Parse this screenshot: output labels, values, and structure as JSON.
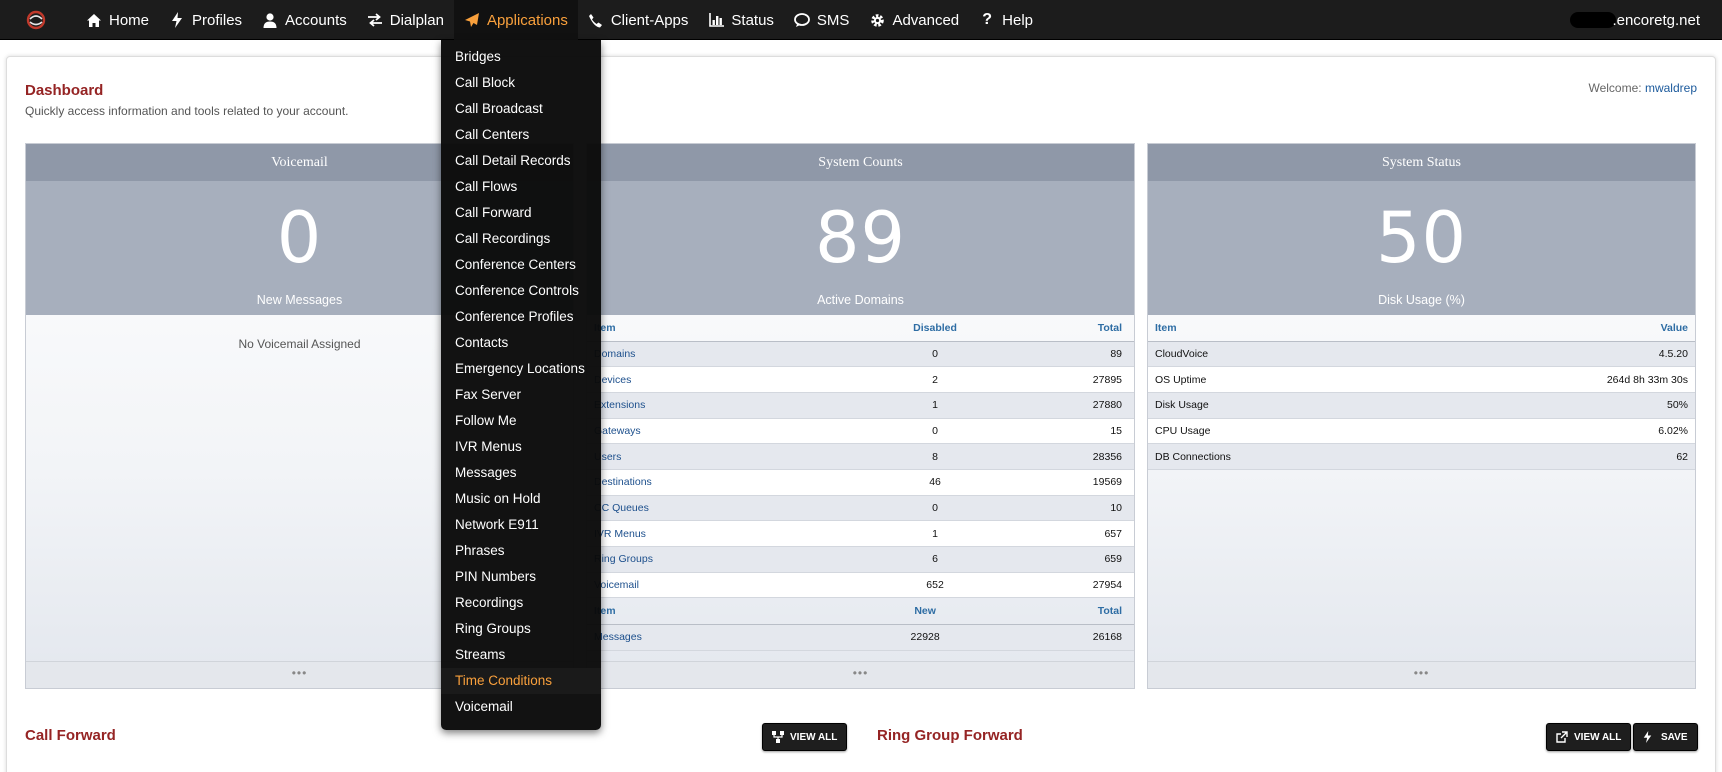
{
  "nav": {
    "items": [
      {
        "label": "Home",
        "icon": "home-icon"
      },
      {
        "label": "Profiles",
        "icon": "bolt-icon"
      },
      {
        "label": "Accounts",
        "icon": "user-icon"
      },
      {
        "label": "Dialplan",
        "icon": "exchange-icon"
      },
      {
        "label": "Applications",
        "icon": "paper-plane-icon"
      },
      {
        "label": "Client-Apps",
        "icon": "phone-icon"
      },
      {
        "label": "Status",
        "icon": "bar-chart-icon"
      },
      {
        "label": "SMS",
        "icon": "comment-icon"
      },
      {
        "label": "Advanced",
        "icon": "gear-icon"
      },
      {
        "label": "Help",
        "icon": "question-icon"
      }
    ],
    "active": "Applications",
    "active_color": "#f9a03c",
    "domain": ".encoretg.net"
  },
  "dropdown": {
    "items": [
      "Bridges",
      "Call Block",
      "Call Broadcast",
      "Call Centers",
      "Call Detail Records",
      "Call Flows",
      "Call Forward",
      "Call Recordings",
      "Conference Centers",
      "Conference Controls",
      "Conference Profiles",
      "Contacts",
      "Emergency Locations",
      "Fax Server",
      "Follow Me",
      "IVR Menus",
      "Messages",
      "Music on Hold",
      "Network E911",
      "Phrases",
      "PIN Numbers",
      "Recordings",
      "Ring Groups",
      "Streams",
      "Time Conditions",
      "Voicemail"
    ],
    "highlighted": "Time Conditions"
  },
  "dashboard": {
    "title": "Dashboard",
    "subtitle": "Quickly access information and tools related to your account.",
    "welcome_label": "Welcome:",
    "username": "mwaldrep"
  },
  "widgets": {
    "voicemail": {
      "title": "Voicemail",
      "value": "0",
      "label": "New Messages",
      "empty_text": "No Voicemail Assigned",
      "footer": "•••"
    },
    "counts": {
      "title": "System Counts",
      "value": "89",
      "label": "Active Domains",
      "header": {
        "item": "Item",
        "disabled": "Disabled",
        "total": "Total"
      },
      "rows": [
        {
          "item": "Domains",
          "disabled": "0",
          "total": "89"
        },
        {
          "item": "Devices",
          "disabled": "2",
          "total": "27895"
        },
        {
          "item": "Extensions",
          "disabled": "1",
          "total": "27880"
        },
        {
          "item": "Gateways",
          "disabled": "0",
          "total": "15"
        },
        {
          "item": "Users",
          "disabled": "8",
          "total": "28356"
        },
        {
          "item": "Destinations",
          "disabled": "46",
          "total": "19569"
        },
        {
          "item": "CC Queues",
          "disabled": "0",
          "total": "10"
        },
        {
          "item": "IVR Menus",
          "disabled": "1",
          "total": "657"
        },
        {
          "item": "Ring Groups",
          "disabled": "6",
          "total": "659"
        },
        {
          "item": "Voicemail",
          "disabled": "652",
          "total": "27954"
        }
      ],
      "header2": {
        "item": "Item",
        "new": "New",
        "total": "Total"
      },
      "rows2": [
        {
          "item": "Messages",
          "new": "22928",
          "total": "26168"
        }
      ],
      "footer": "•••"
    },
    "status": {
      "title": "System Status",
      "value": "50",
      "label": "Disk Usage (%)",
      "header": {
        "item": "Item",
        "value": "Value"
      },
      "rows": [
        {
          "item": "CloudVoice",
          "value": "4.5.20"
        },
        {
          "item": "OS Uptime",
          "value": "264d 8h 33m 30s"
        },
        {
          "item": "Disk Usage",
          "value": "50%"
        },
        {
          "item": "CPU Usage",
          "value": "6.02%"
        },
        {
          "item": "DB Connections",
          "value": "62"
        }
      ],
      "footer": "•••"
    }
  },
  "sections": {
    "call_forward": {
      "title": "Call Forward",
      "view_all": "VIEW ALL"
    },
    "ring_group_forward": {
      "title": "Ring Group Forward",
      "view_all": "VIEW ALL",
      "save": "SAVE"
    }
  }
}
